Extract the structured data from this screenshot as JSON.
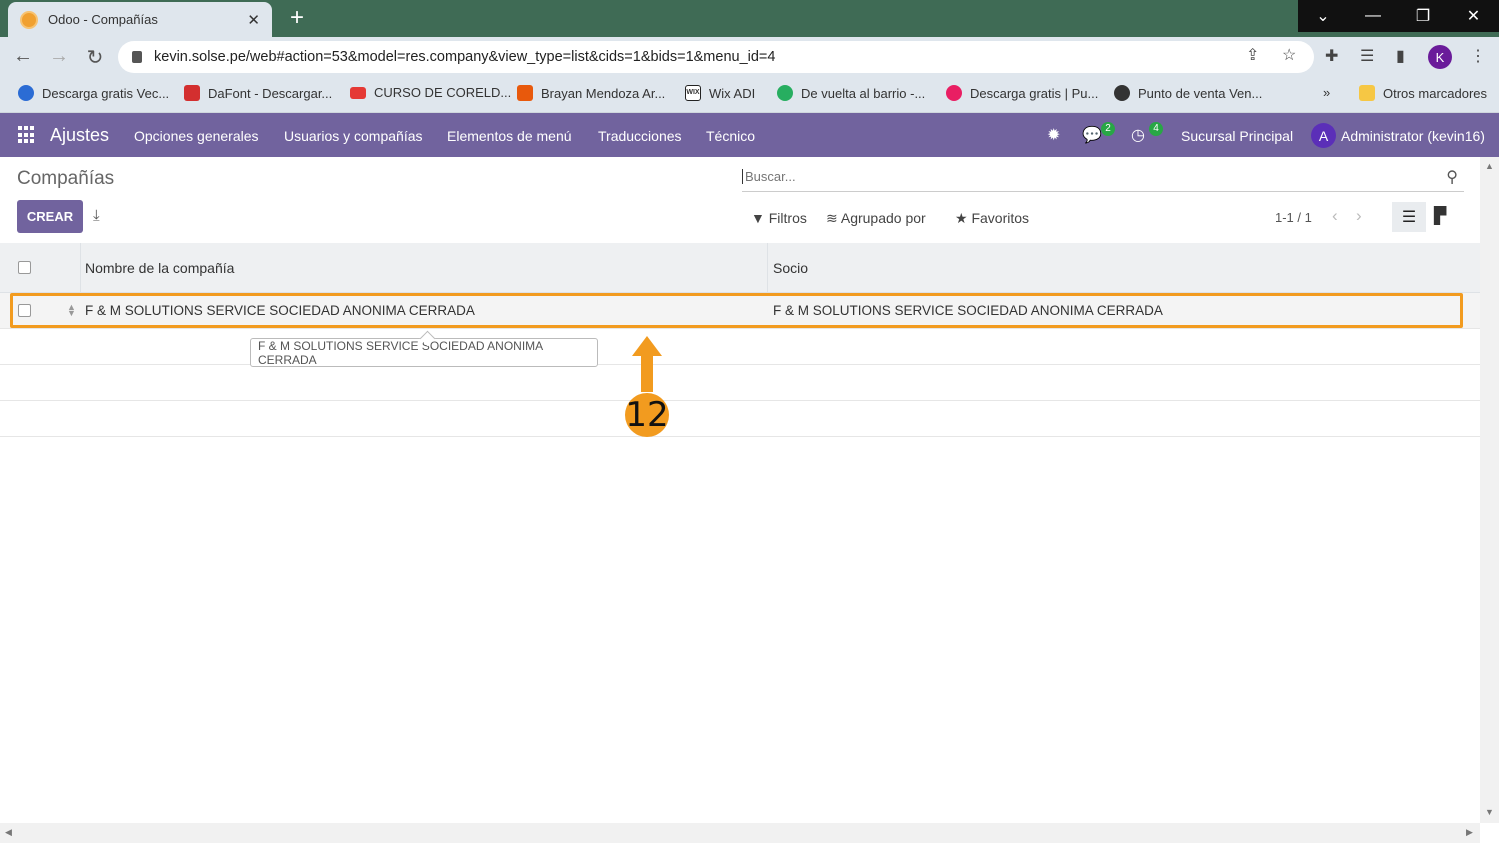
{
  "browser": {
    "tab_title": "Odoo - Compañías",
    "url": "kevin.solse.pe/web#action=53&model=res.company&view_type=list&cids=1&bids=1&menu_id=4",
    "profile_initial": "K",
    "bookmarks": [
      {
        "label": "Descarga gratis Vec...",
        "color": "#2b6cd4"
      },
      {
        "label": "DaFont - Descargar...",
        "color": "#d32f2f"
      },
      {
        "label": "CURSO DE CORELD...",
        "color": "#e53935"
      },
      {
        "label": "Brayan Mendoza Ar...",
        "color": "#e8590c"
      },
      {
        "label": "Wix ADI",
        "color": "#222222"
      },
      {
        "label": "De vuelta al barrio -...",
        "color": "#27ae60"
      },
      {
        "label": "Descarga gratis | Pu...",
        "color": "#e91e63"
      },
      {
        "label": "Punto de venta Ven...",
        "color": "#333333"
      }
    ],
    "bookmarks_more": "»",
    "other_bookmarks": "Otros marcadores"
  },
  "odoo": {
    "brand": "Ajustes",
    "menu": [
      "Opciones generales",
      "Usuarios y compañías",
      "Elementos de menú",
      "Traducciones",
      "Técnico"
    ],
    "messages_badge": "2",
    "activities_badge": "4",
    "branch": "Sucursal Principal",
    "user_initial": "A",
    "user": "Administrator (kevin16)",
    "accent": "#71639e"
  },
  "control": {
    "title": "Compañías",
    "search_placeholder": "Buscar...",
    "create_label": "CREAR",
    "filters": "Filtros",
    "group_by": "Agrupado por",
    "favorites": "Favoritos",
    "pager": "1-1 / 1"
  },
  "table": {
    "headers": [
      "Nombre de la compañía",
      "Socio"
    ],
    "rows": [
      {
        "name": "F & M SOLUTIONS SERVICE SOCIEDAD ANONIMA CERRADA",
        "partner": "F & M SOLUTIONS SERVICE SOCIEDAD ANONIMA CERRADA"
      }
    ]
  },
  "tooltip": "F & M SOLUTIONS SERVICE SOCIEDAD ANONIMA CERRADA",
  "annotation": {
    "step": "12",
    "color": "#f29b1f"
  }
}
